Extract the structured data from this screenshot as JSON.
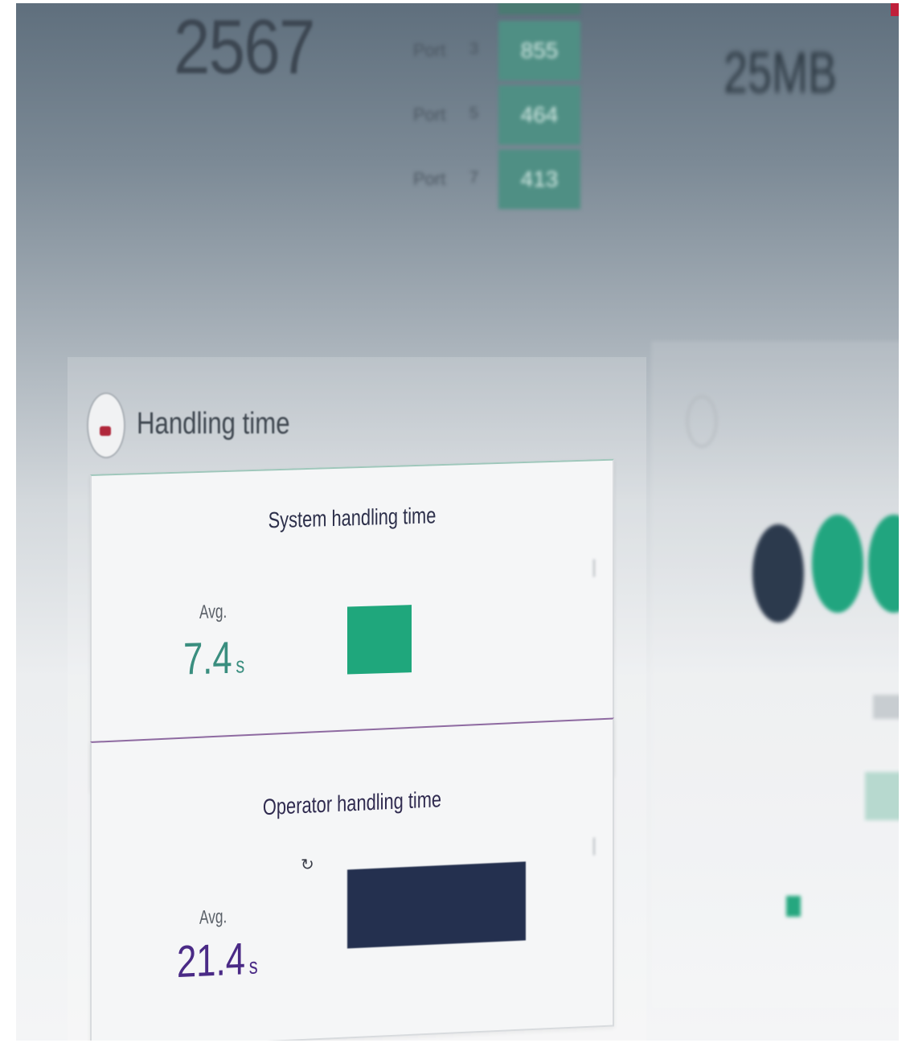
{
  "top_region": {
    "big_count": "2567",
    "ports": [
      {
        "label": "Port",
        "num": "3",
        "value": "855"
      },
      {
        "label": "Port",
        "num": "5",
        "value": "464"
      },
      {
        "label": "Port",
        "num": "7",
        "value": "413"
      }
    ],
    "right_metric": "25MB"
  },
  "handling_panel": {
    "title": "Handling time",
    "system": {
      "title": "System handling time",
      "avg_label": "Avg.",
      "avg_value": "7.4",
      "unit": "s",
      "bar_color": "#1fa77c"
    },
    "operator": {
      "title": "Operator handling time",
      "avg_label": "Avg.",
      "avg_value": "21.4",
      "unit": "s",
      "bar_color": "#24304f"
    }
  },
  "colors": {
    "accent_green": "#1fa77c",
    "accent_navy": "#24304f",
    "accent_purple": "#4a2a86",
    "brand_red": "#c0203a"
  }
}
